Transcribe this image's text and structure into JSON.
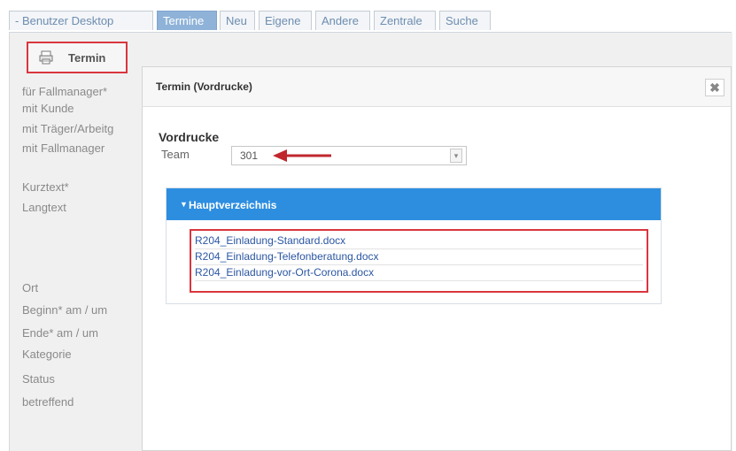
{
  "tabs": [
    {
      "label": "- Benutzer Desktop",
      "active": false
    },
    {
      "label": "Termine",
      "active": true
    },
    {
      "label": "Neu",
      "active": false
    },
    {
      "label": "Eigene",
      "active": false
    },
    {
      "label": "Andere",
      "active": false
    },
    {
      "label": "Zentrale",
      "active": false
    },
    {
      "label": "Suche",
      "active": false
    }
  ],
  "termin_button": {
    "label": "Termin",
    "icon": "printer-document-icon"
  },
  "form_labels": [
    "für Fallmanager*",
    "mit Kunde",
    "mit Träger/Arbeitg",
    "mit Fallmanager",
    "Kurztext*",
    "Langtext",
    "Ort",
    "Beginn* am / um",
    "Ende* am / um",
    "Kategorie",
    "Status",
    "betreffend"
  ],
  "dialog": {
    "title": "Termin (Vordrucke)",
    "close_symbol": "✖",
    "section_title": "Vordrucke",
    "team_label": "Team",
    "team_value": "301",
    "select_arrow": "▾",
    "panel_caret": "▼",
    "panel_title": "Hauptverzeichnis",
    "documents": [
      "R204_Einladung-Standard.docx",
      "R204_Einladung-Telefonberatung.docx",
      "R204_Einladung-vor-Ort-Corona.docx"
    ]
  },
  "colors": {
    "highlight_red": "#d9363e",
    "panel_blue": "#2d8ee0",
    "link_blue": "#2b56a3",
    "active_tab": "#8fb3d8"
  }
}
